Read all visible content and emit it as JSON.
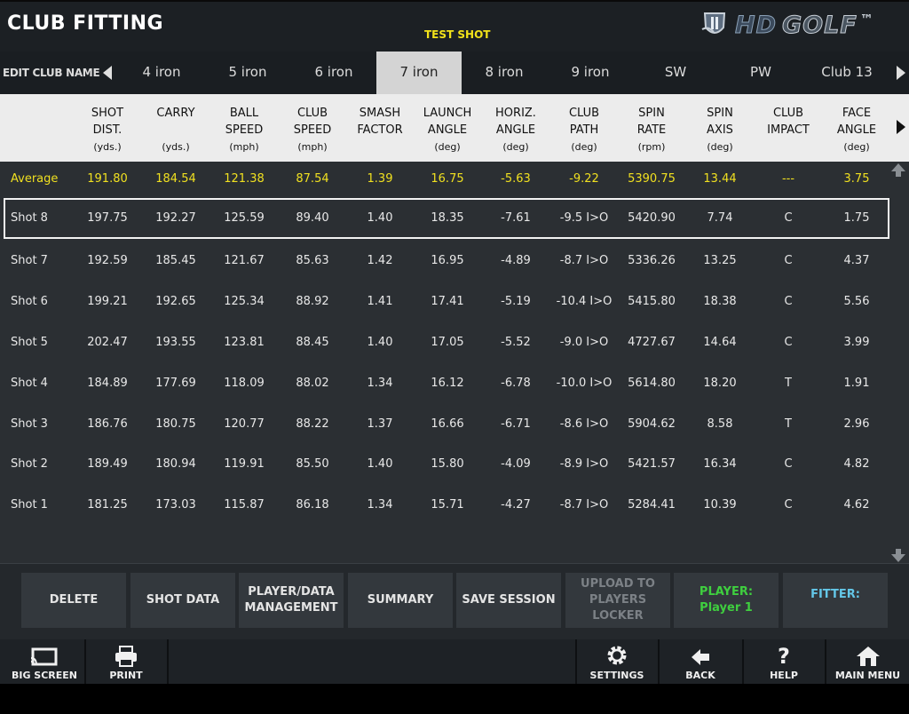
{
  "header": {
    "title": "CLUB FITTING",
    "mode": "TEST SHOT",
    "logo": {
      "hd": "HD",
      "golf": "GOLF",
      "tm": "™"
    }
  },
  "clubs": {
    "edit_label": "EDIT CLUB NAME",
    "tabs": [
      "4 iron",
      "5 iron",
      "6 iron",
      "7 iron",
      "8 iron",
      "9 iron",
      "SW",
      "PW",
      "Club 13"
    ],
    "active": "7 iron"
  },
  "columns": [
    {
      "l1": "",
      "l2": "",
      "unit": ""
    },
    {
      "l1": "SHOT",
      "l2": "DIST.",
      "unit": "(yds.)"
    },
    {
      "l1": "CARRY",
      "l2": "",
      "unit": "(yds.)"
    },
    {
      "l1": "BALL",
      "l2": "SPEED",
      "unit": "(mph)"
    },
    {
      "l1": "CLUB",
      "l2": "SPEED",
      "unit": "(mph)"
    },
    {
      "l1": "SMASH",
      "l2": "FACTOR",
      "unit": ""
    },
    {
      "l1": "LAUNCH",
      "l2": "ANGLE",
      "unit": "(deg)"
    },
    {
      "l1": "HORIZ.",
      "l2": "ANGLE",
      "unit": "(deg)"
    },
    {
      "l1": "CLUB",
      "l2": "PATH",
      "unit": "(deg)"
    },
    {
      "l1": "SPIN",
      "l2": "RATE",
      "unit": "(rpm)"
    },
    {
      "l1": "SPIN",
      "l2": "AXIS",
      "unit": "(deg)"
    },
    {
      "l1": "CLUB",
      "l2": "IMPACT",
      "unit": ""
    },
    {
      "l1": "FACE",
      "l2": "ANGLE",
      "unit": "(deg)"
    }
  ],
  "average": [
    "Average",
    "191.80",
    "184.54",
    "121.38",
    "87.54",
    "1.39",
    "16.75",
    "-5.63",
    "-9.22",
    "5390.75",
    "13.44",
    "---",
    "3.75"
  ],
  "shots": [
    [
      "Shot 8",
      "197.75",
      "192.27",
      "125.59",
      "89.40",
      "1.40",
      "18.35",
      "-7.61",
      "-9.5 I>O",
      "5420.90",
      "7.74",
      "C",
      "1.75"
    ],
    [
      "Shot 7",
      "192.59",
      "185.45",
      "121.67",
      "85.63",
      "1.42",
      "16.95",
      "-4.89",
      "-8.7 I>O",
      "5336.26",
      "13.25",
      "C",
      "4.37"
    ],
    [
      "Shot 6",
      "199.21",
      "192.65",
      "125.34",
      "88.92",
      "1.41",
      "17.41",
      "-5.19",
      "-10.4 I>O",
      "5415.80",
      "18.38",
      "C",
      "5.56"
    ],
    [
      "Shot 5",
      "202.47",
      "193.55",
      "123.81",
      "88.45",
      "1.40",
      "17.05",
      "-5.52",
      "-9.0 I>O",
      "4727.67",
      "14.64",
      "C",
      "3.99"
    ],
    [
      "Shot 4",
      "184.89",
      "177.69",
      "118.09",
      "88.02",
      "1.34",
      "16.12",
      "-6.78",
      "-10.0 I>O",
      "5614.80",
      "18.20",
      "T",
      "1.91"
    ],
    [
      "Shot 3",
      "186.76",
      "180.75",
      "120.77",
      "88.22",
      "1.37",
      "16.66",
      "-6.71",
      "-8.6 I>O",
      "5904.62",
      "8.58",
      "T",
      "2.96"
    ],
    [
      "Shot 2",
      "189.49",
      "180.94",
      "119.91",
      "85.50",
      "1.40",
      "15.80",
      "-4.09",
      "-8.9 I>O",
      "5421.57",
      "16.34",
      "C",
      "4.82"
    ],
    [
      "Shot 1",
      "181.25",
      "173.03",
      "115.87",
      "86.18",
      "1.34",
      "15.71",
      "-4.27",
      "-8.7 I>O",
      "5284.41",
      "10.39",
      "C",
      "4.62"
    ]
  ],
  "selected_shot": "Shot 8",
  "actions": {
    "delete": "DELETE",
    "shot_data": "SHOT DATA",
    "player_data_1": "PLAYER/DATA",
    "player_data_2": "MANAGEMENT",
    "summary": "SUMMARY",
    "save_session": "SAVE SESSION",
    "upload_1": "UPLOAD TO",
    "upload_2": "PLAYERS LOCKER",
    "player_label": "PLAYER:",
    "player_name": "Player 1",
    "fitter_label": "FITTER:"
  },
  "bottom": {
    "big_screen": "BIG SCREEN",
    "print": "PRINT",
    "settings": "SETTINGS",
    "back": "BACK",
    "help": "HELP",
    "main_menu": "MAIN MENU"
  },
  "colors": {
    "average_text": "#f0e020",
    "player_text": "#3fcf3f",
    "fitter_text": "#64c7e8",
    "active_tab": "#d4d4d4"
  },
  "icons": {
    "big_screen": "screen-cast-icon",
    "print": "printer-icon",
    "settings": "gear-icon",
    "back": "back-arrow-icon",
    "help": "question-icon",
    "main_menu": "home-icon"
  }
}
